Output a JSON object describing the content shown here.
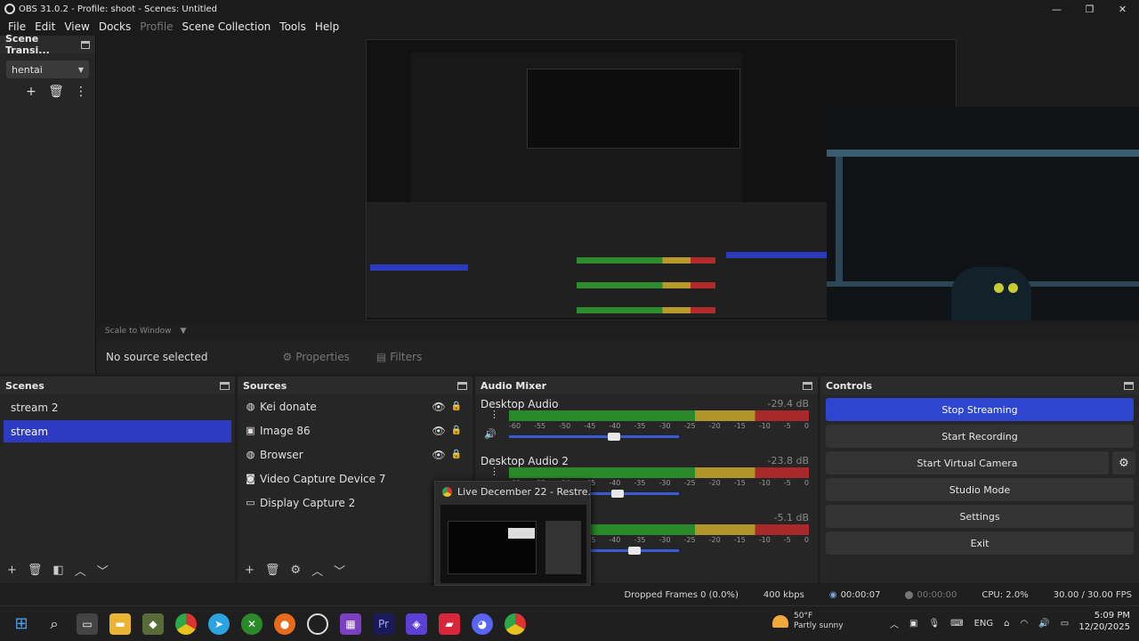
{
  "window": {
    "title": "OBS 31.0.2 - Profile: shoot - Scenes: Untitled"
  },
  "menu": [
    "File",
    "Edit",
    "View",
    "Docks",
    "Profile",
    "Scene Collection",
    "Tools",
    "Help"
  ],
  "scene_transitions": {
    "title": "Scene Transi...",
    "selected": "hentai"
  },
  "preview": {
    "scale_label": "Scale to Window"
  },
  "source_toolbar": {
    "no_source": "No source selected",
    "properties": "Properties",
    "filters": "Filters"
  },
  "scenes": {
    "title": "Scenes",
    "items": [
      "stream 2",
      "stream"
    ],
    "selected_index": 1
  },
  "sources": {
    "title": "Sources",
    "items": [
      {
        "name": "Kei donate",
        "icon": "globe-icon"
      },
      {
        "name": "Image 86",
        "icon": "image-icon"
      },
      {
        "name": "Browser",
        "icon": "globe-icon"
      },
      {
        "name": "Video Capture Device 7",
        "icon": "camera-icon"
      },
      {
        "name": "Display Capture 2",
        "icon": "monitor-icon"
      }
    ]
  },
  "audio_mixer": {
    "title": "Audio Mixer",
    "channels": [
      {
        "name": "Desktop Audio",
        "db": "-29.4 dB",
        "fader": 0.62
      },
      {
        "name": "Desktop Audio 2",
        "db": "-23.8 dB",
        "fader": 0.64
      },
      {
        "name": "",
        "db": "-5.1 dB",
        "fader": 0.74
      }
    ],
    "scale": [
      "-60",
      "-55",
      "-50",
      "-45",
      "-40",
      "-35",
      "-30",
      "-25",
      "-20",
      "-15",
      "-10",
      "-5",
      "0"
    ]
  },
  "controls": {
    "title": "Controls",
    "buttons": [
      "Stop Streaming",
      "Start Recording",
      "Start Virtual Camera",
      "Studio Mode",
      "Settings",
      "Exit"
    ]
  },
  "taskbar_preview": {
    "title": "Live December 22 - Restre..."
  },
  "status": {
    "dropped": "Dropped Frames 0 (0.0%)",
    "kbps": "400 kbps",
    "stream_time": "00:00:07",
    "rec_time": "00:00:00",
    "cpu": "CPU: 2.0%",
    "fps": "30.00 / 30.00 FPS"
  },
  "weather": {
    "temp": "50°F",
    "desc": "Partly sunny"
  },
  "clock": {
    "time": "5:09 PM",
    "date": "12/20/2025"
  },
  "tray": {
    "lang": "ENG"
  }
}
